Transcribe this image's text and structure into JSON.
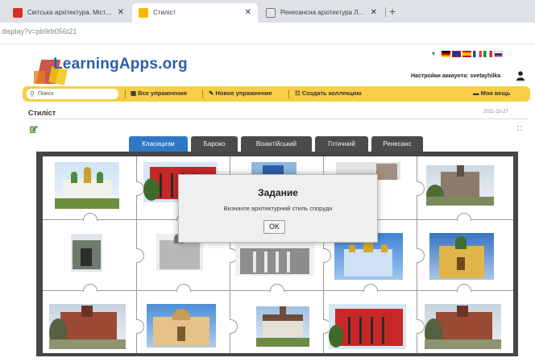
{
  "browser": {
    "tabs": [
      {
        "title": "Світська архітектура. Містобуд",
        "favicon_color": "#d93025",
        "active": false
      },
      {
        "title": "Стиліст",
        "favicon_color": "#f5b800",
        "active": true
      },
      {
        "title": "Ренесансна архітектура Львов",
        "favicon_color": "#555555",
        "active": false
      }
    ],
    "close_glyph": "✕",
    "new_tab_glyph": "+",
    "address": "display?v=pb9rb056t21"
  },
  "site": {
    "logo_text": "LearningApps.org",
    "language_dropdown_glyph": "▾",
    "flags": [
      "de",
      "gb",
      "es",
      "fr",
      "it",
      "ru"
    ],
    "account_text": "Настройки аккаунта: svetayhilka",
    "toolbar": {
      "search_placeholder": "Поиск",
      "items": [
        {
          "icon": "grid-icon",
          "glyph": "▦",
          "label": "Все упражнения"
        },
        {
          "icon": "pencil-icon",
          "glyph": "✎",
          "label": "Новое упражнение"
        },
        {
          "icon": "collection-icon",
          "glyph": "☷",
          "label": "Создать коллекцию"
        },
        {
          "icon": "folder-icon",
          "glyph": "▬",
          "label": "Моя вещь"
        }
      ]
    }
  },
  "page": {
    "title": "Стиліст",
    "date": "2021-10-27"
  },
  "categories": [
    {
      "label": "Класицизм",
      "active": true
    },
    {
      "label": "Бароко",
      "active": false
    },
    {
      "label": "Візантійський",
      "active": false
    },
    {
      "label": "Готичний",
      "active": false
    },
    {
      "label": "Ренесанс",
      "active": false
    }
  ],
  "modal": {
    "title": "Задание",
    "text": "Визначте архітектурний стиль споруди",
    "button": "OK"
  },
  "colors": {
    "accent": "#2f78c4",
    "toolbar": "#f7ce46",
    "logo": "#2d5fa6",
    "board": "#464646"
  }
}
